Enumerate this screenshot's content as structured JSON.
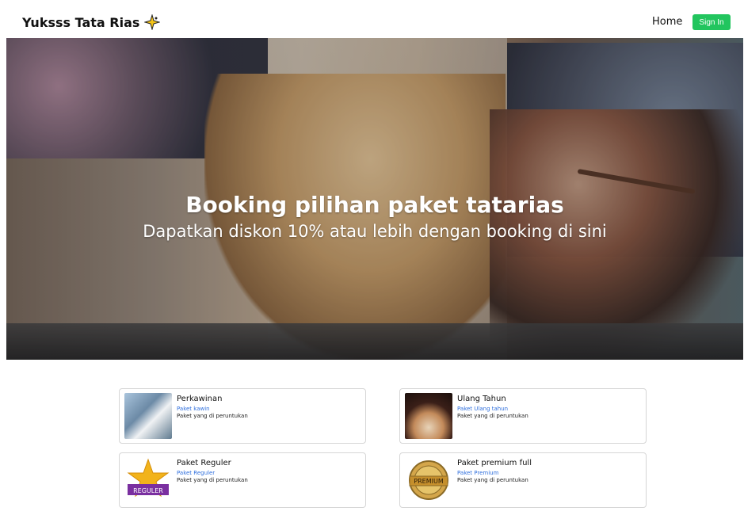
{
  "navbar": {
    "brand": "Yuksss Tata Rias",
    "brand_icon": "sparkle-icon",
    "home": "Home",
    "signin": "Sign In",
    "signin_color": "#22c55e"
  },
  "hero": {
    "title": "Booking pilihan paket tatarias",
    "subtitle": "Dapatkan diskon 10% atau lebih dengan booking di sini"
  },
  "cards": [
    {
      "title": "Perkawinan",
      "sub": "Paket kawin",
      "desc": "Paket yang di peruntukan",
      "image": "wedding-photo"
    },
    {
      "title": "Ulang Tahun",
      "sub": "Paket Ulang tahun",
      "desc": "Paket yang di peruntukan",
      "image": "birthday-cake-photo"
    },
    {
      "title": "Paket Reguler",
      "sub": "Paket Reguler",
      "desc": "Paket yang di peruntukan",
      "image": "reguler-badge-icon",
      "badge_text": "REGULER"
    },
    {
      "title": "Paket premium full",
      "sub": "Paket Premium",
      "desc": "Paket yang di peruntukan",
      "image": "premium-seal-icon",
      "badge_text": "PREMIUM"
    }
  ]
}
